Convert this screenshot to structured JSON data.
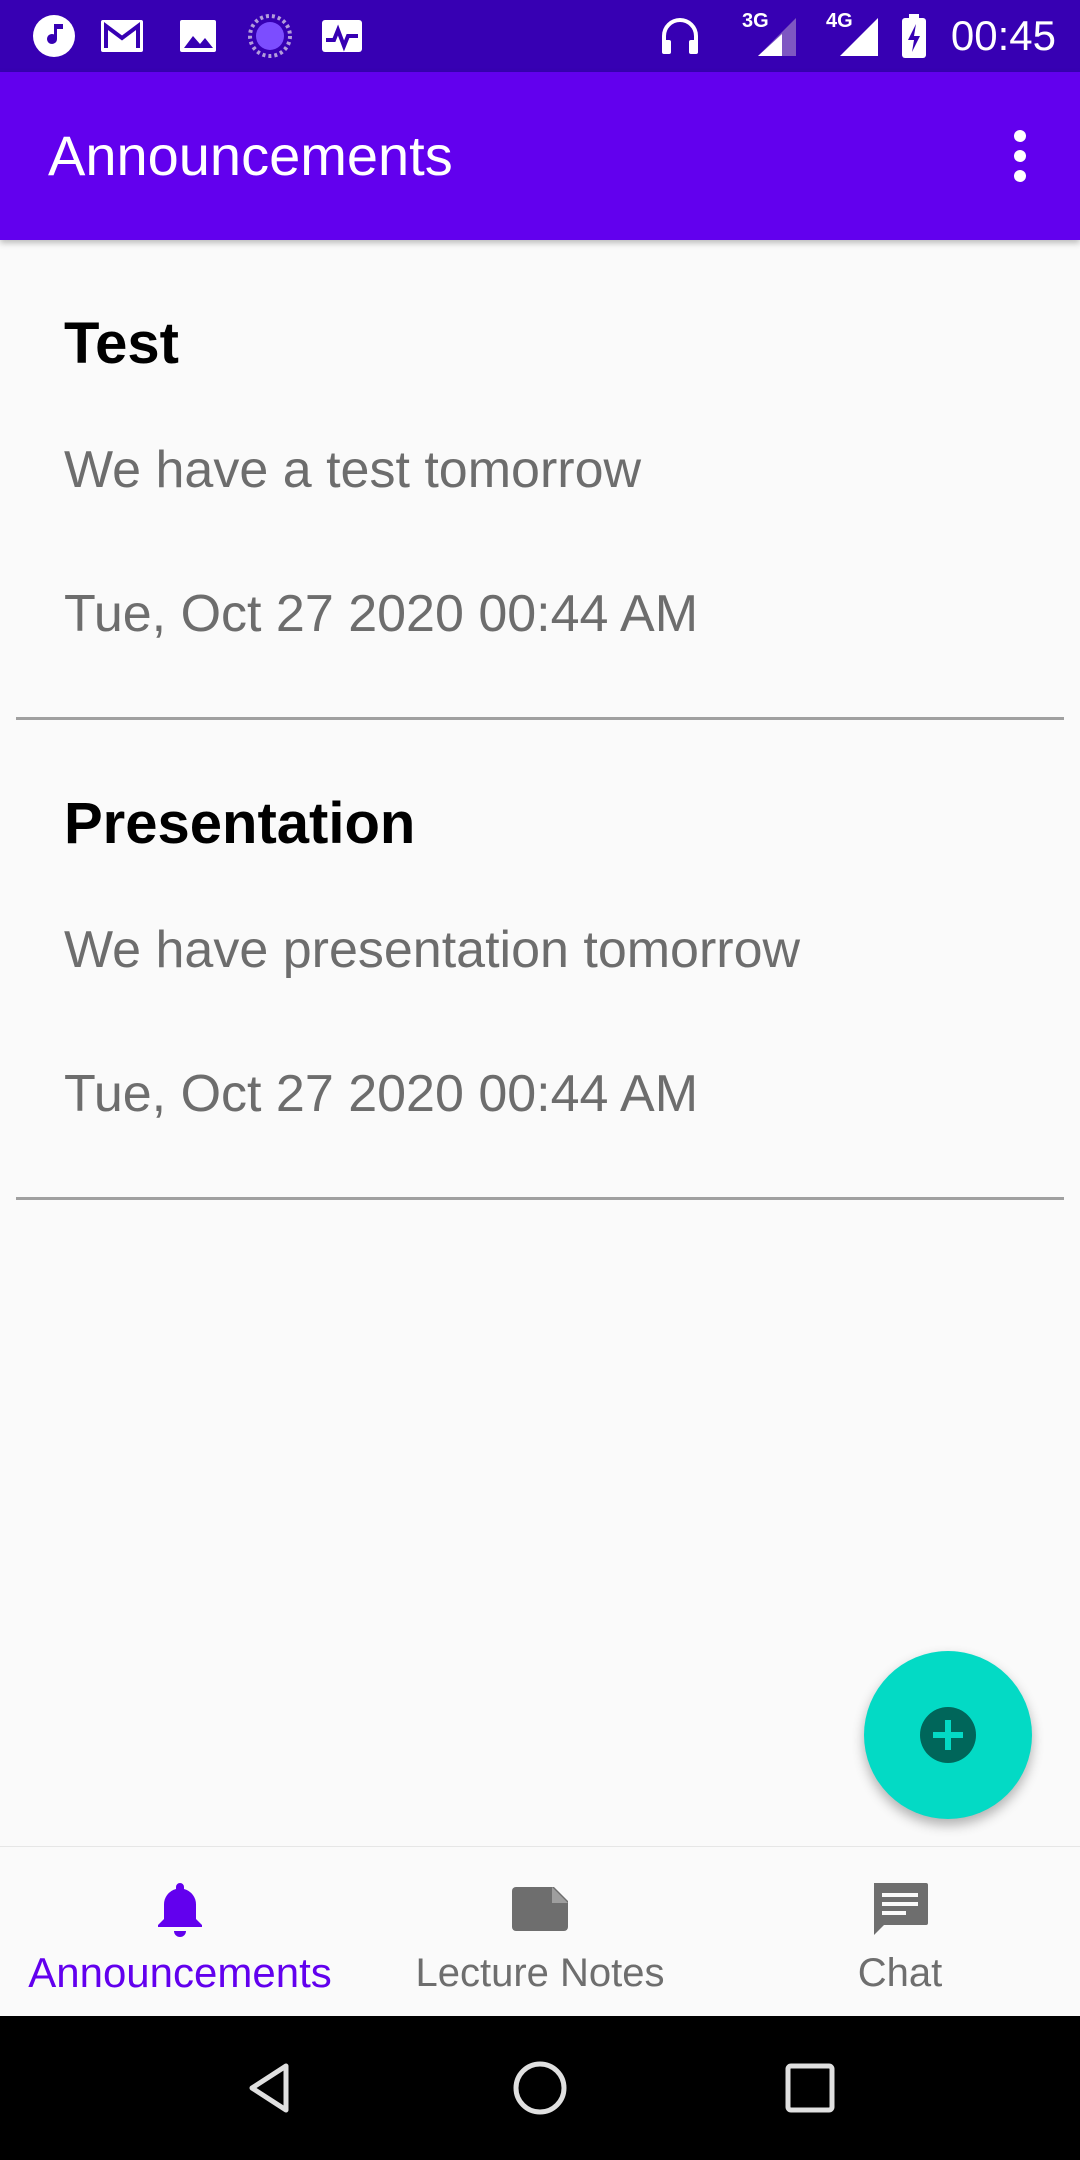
{
  "status_bar": {
    "time": "00:45",
    "left_icons": [
      "music-icon",
      "gmail-icon",
      "image-icon",
      "loading-icon",
      "activity-icon"
    ],
    "right_icons": [
      "headset-icon",
      "signal-3g-icon",
      "signal-4g-icon",
      "battery-charging-icon"
    ],
    "network_3g": "3G",
    "network_4g": "4G"
  },
  "app_bar": {
    "title": "Announcements",
    "menu_icon": "more-vert-icon"
  },
  "announcements": [
    {
      "title": "Test",
      "body": "We have a test tomorrow",
      "date": "Tue, Oct 27 2020 00:44 AM"
    },
    {
      "title": "Presentation",
      "body": "We have presentation tomorrow",
      "date": "Tue, Oct 27 2020 00:44 AM"
    }
  ],
  "fab": {
    "icon": "add-circle-icon"
  },
  "bottom_nav": {
    "items": [
      {
        "label": "Announcements",
        "icon": "bell-icon",
        "active": true
      },
      {
        "label": "Lecture Notes",
        "icon": "note-icon",
        "active": false
      },
      {
        "label": "Chat",
        "icon": "chat-icon",
        "active": false
      }
    ]
  },
  "system_nav": [
    "back-icon",
    "home-icon",
    "recents-icon"
  ],
  "colors": {
    "status_bar": "#3700b3",
    "primary": "#6200ee",
    "fab": "#03dac5",
    "inactive": "#6e6e6e"
  }
}
